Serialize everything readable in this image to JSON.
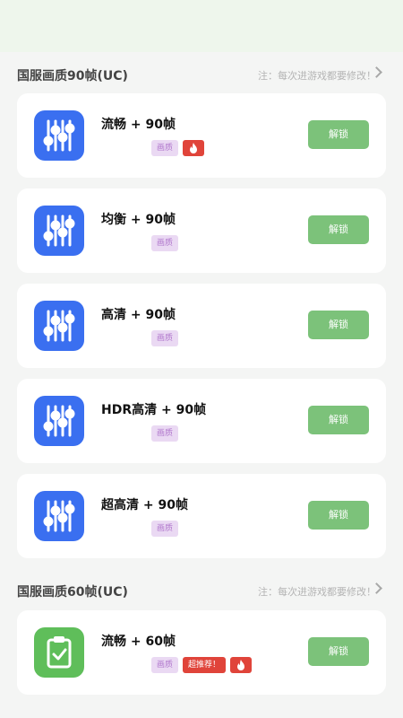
{
  "sections": [
    {
      "title": "国服画质90帧(UC)",
      "note": "注：每次进游戏都要修改！",
      "cards": [
        {
          "title": "流畅 + 90帧",
          "quality_tag": "画质",
          "button": "解锁"
        },
        {
          "title": "均衡 + 90帧",
          "quality_tag": "画质",
          "button": "解锁"
        },
        {
          "title": "高清 + 90帧",
          "quality_tag": "画质",
          "button": "解锁"
        },
        {
          "title": "HDR高清 + 90帧",
          "quality_tag": "画质",
          "button": "解锁"
        },
        {
          "title": "超高清 + 90帧",
          "quality_tag": "画质",
          "button": "解锁"
        }
      ]
    },
    {
      "title": "国服画质60帧(UC)",
      "note": "注：每次进游戏都要修改！",
      "cards": [
        {
          "title": "流畅 + 60帧",
          "quality_tag": "画质",
          "recommend_tag": "超推荐！",
          "button": "解锁"
        }
      ]
    }
  ],
  "icons": {
    "sliders": "sliders-icon",
    "clipboard": "clipboard-check-icon",
    "fire": "fire-icon",
    "chevron": "chevron-right-icon"
  },
  "colors": {
    "blue_icon": "#3a6ff0",
    "green_icon": "#5fbe5a",
    "unlock_button": "#7cc27a",
    "hot_tag": "#e0443a",
    "quality_tag_bg": "#ead9f3"
  }
}
